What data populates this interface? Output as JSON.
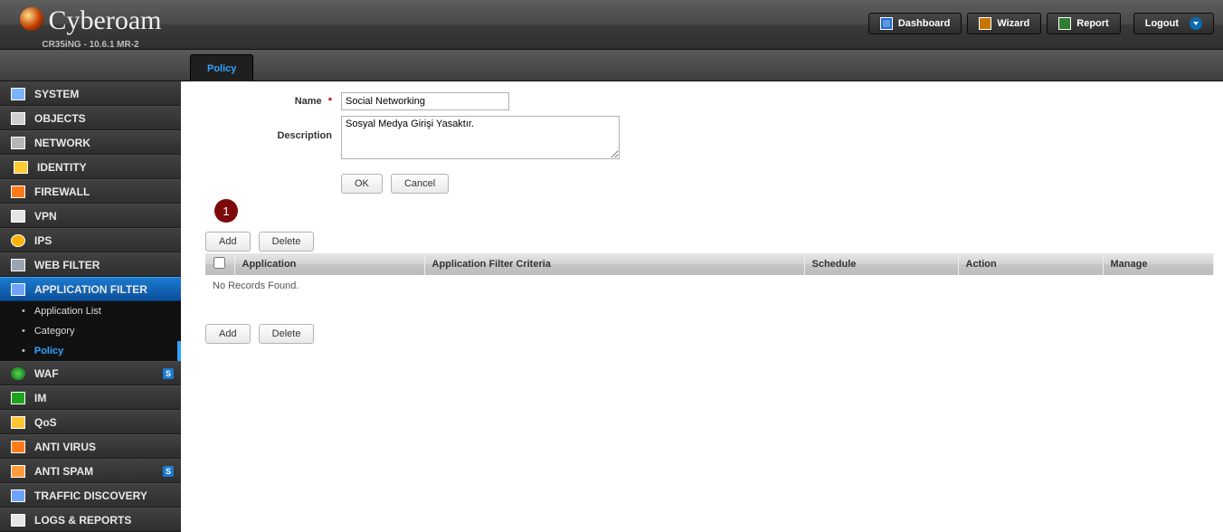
{
  "brand": {
    "name": "Cyberoam",
    "sub": "CR35iNG - 10.6.1 MR-2"
  },
  "top_buttons": {
    "dashboard": "Dashboard",
    "wizard": "Wizard",
    "report": "Report",
    "logout": "Logout"
  },
  "tabs": {
    "active": "Policy"
  },
  "sidebar": {
    "items": [
      {
        "label": "SYSTEM"
      },
      {
        "label": "OBJECTS"
      },
      {
        "label": "NETWORK"
      },
      {
        "label": "IDENTITY"
      },
      {
        "label": "FIREWALL"
      },
      {
        "label": "VPN"
      },
      {
        "label": "IPS"
      },
      {
        "label": "WEB FILTER"
      },
      {
        "label": "APPLICATION FILTER"
      },
      {
        "label": "WAF"
      },
      {
        "label": "IM"
      },
      {
        "label": "QoS"
      },
      {
        "label": "ANTI VIRUS"
      },
      {
        "label": "ANTI SPAM"
      },
      {
        "label": "TRAFFIC DISCOVERY"
      },
      {
        "label": "LOGS & REPORTS"
      }
    ],
    "appfilter_sub": [
      {
        "label": "Application List"
      },
      {
        "label": "Category"
      },
      {
        "label": "Policy"
      }
    ],
    "badge": "S"
  },
  "form": {
    "name_label": "Name",
    "name_value": "Social Networking",
    "desc_label": "Description",
    "desc_value": "Sosyal Medya Girişi Yasaktır.",
    "ok": "OK",
    "cancel": "Cancel",
    "add": "Add",
    "delete": "Delete"
  },
  "callout": "1",
  "table": {
    "headers": {
      "app": "Application",
      "criteria": "Application Filter Criteria",
      "schedule": "Schedule",
      "action": "Action",
      "manage": "Manage"
    },
    "empty": "No Records Found."
  }
}
